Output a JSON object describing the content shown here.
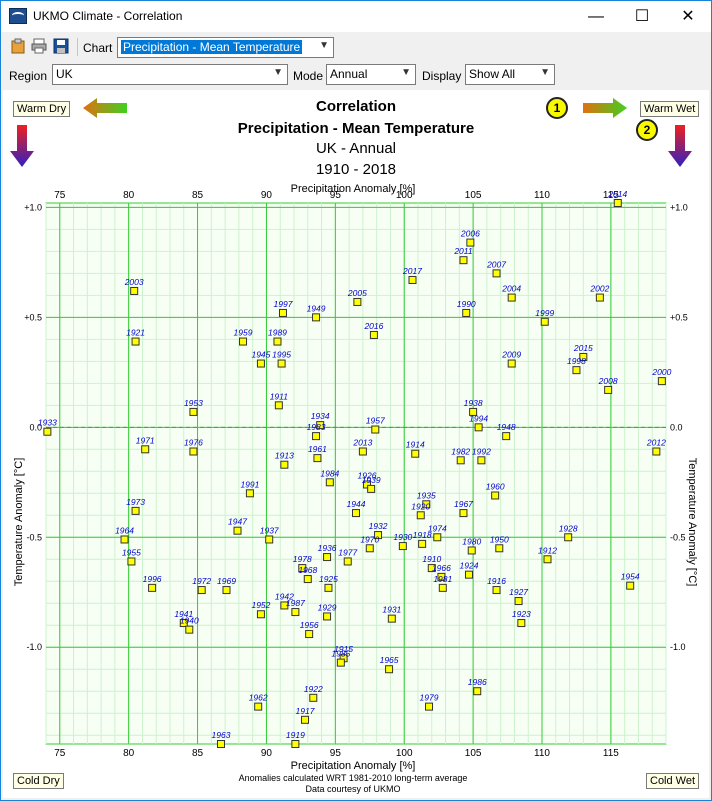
{
  "window": {
    "title": "UKMO Climate - Correlation",
    "minimize": "—",
    "maximize": "☐",
    "close": "✕"
  },
  "toolbar": {
    "chart_label": "Chart",
    "chart_value": "Precipitation - Mean Temperature"
  },
  "filters": {
    "region_label": "Region",
    "region_value": "UK",
    "mode_label": "Mode",
    "mode_value": "Annual",
    "display_label": "Display",
    "display_value": "Show All"
  },
  "corners": {
    "warm_dry": "Warm Dry",
    "warm_wet": "Warm Wet",
    "cold_dry": "Cold Dry",
    "cold_wet": "Cold Wet",
    "badge1": "1",
    "badge2": "2"
  },
  "footer": {
    "note1": "Anomalies calculated WRT 1981-2010 long-term average",
    "note2": "Data courtesy of UKMO"
  },
  "colors": {
    "grid_major": "#33cc33",
    "grid_minor": "#ccf2cc",
    "point": "#ffff00",
    "label": "#0000cc",
    "zero": "#33aa33"
  },
  "chart_data": {
    "type": "scatter",
    "title": "Correlation",
    "subtitle": "Precipitation - Mean Temperature",
    "subtitle2": "UK - Annual",
    "subtitle3": "1910 - 2018",
    "xlabel": "Precipitation Anomaly [%]",
    "ylabel": "Temperature Anomaly [°C]",
    "xlim": [
      74,
      119
    ],
    "ylim": [
      -1.44,
      1.02
    ],
    "xticks": [
      75,
      80,
      85,
      90,
      95,
      100,
      105,
      110,
      115
    ],
    "yticks": [
      1.0,
      0.5,
      0.0,
      -0.5,
      -1.0
    ],
    "ytick_labels": [
      "+1.0",
      "+0.5",
      "0.0",
      "-0.5",
      "-1.0"
    ],
    "points": [
      {
        "label": "2014",
        "x": 115.5,
        "y": 1.02
      },
      {
        "label": "2006",
        "x": 104.8,
        "y": 0.84
      },
      {
        "label": "2011",
        "x": 104.3,
        "y": 0.76
      },
      {
        "label": "2007",
        "x": 106.7,
        "y": 0.7
      },
      {
        "label": "2017",
        "x": 100.6,
        "y": 0.67
      },
      {
        "label": "2003",
        "x": 80.4,
        "y": 0.62
      },
      {
        "label": "2004",
        "x": 107.8,
        "y": 0.59
      },
      {
        "label": "2002",
        "x": 114.2,
        "y": 0.59
      },
      {
        "label": "2005",
        "x": 96.6,
        "y": 0.57
      },
      {
        "label": "1990",
        "x": 104.5,
        "y": 0.52
      },
      {
        "label": "1997",
        "x": 91.2,
        "y": 0.52
      },
      {
        "label": "1949",
        "x": 93.6,
        "y": 0.5
      },
      {
        "label": "1999",
        "x": 110.2,
        "y": 0.48
      },
      {
        "label": "2016",
        "x": 97.8,
        "y": 0.42
      },
      {
        "label": "1921",
        "x": 80.5,
        "y": 0.39
      },
      {
        "label": "1959",
        "x": 88.3,
        "y": 0.39
      },
      {
        "label": "1989",
        "x": 90.8,
        "y": 0.39
      },
      {
        "label": "2015",
        "x": 113.0,
        "y": 0.32
      },
      {
        "label": "1945",
        "x": 89.6,
        "y": 0.29
      },
      {
        "label": "1995",
        "x": 91.1,
        "y": 0.29
      },
      {
        "label": "2009",
        "x": 107.8,
        "y": 0.29
      },
      {
        "label": "1998",
        "x": 112.5,
        "y": 0.26
      },
      {
        "label": "2000",
        "x": 118.7,
        "y": 0.21
      },
      {
        "label": "2008",
        "x": 114.8,
        "y": 0.17
      },
      {
        "label": "1911",
        "x": 90.9,
        "y": 0.1
      },
      {
        "label": "1938",
        "x": 105.0,
        "y": 0.07
      },
      {
        "label": "1953",
        "x": 84.7,
        "y": 0.07
      },
      {
        "label": "1934",
        "x": 93.9,
        "y": 0.01
      },
      {
        "label": "1994",
        "x": 105.4,
        "y": 0.0
      },
      {
        "label": "1957",
        "x": 97.9,
        "y": -0.01
      },
      {
        "label": "1983",
        "x": 93.6,
        "y": -0.04
      },
      {
        "label": "1933",
        "x": 74.1,
        "y": -0.02
      },
      {
        "label": "1948",
        "x": 107.4,
        "y": -0.04
      },
      {
        "label": "1971",
        "x": 81.2,
        "y": -0.1
      },
      {
        "label": "1976",
        "x": 84.7,
        "y": -0.11
      },
      {
        "label": "2013",
        "x": 97.0,
        "y": -0.11
      },
      {
        "label": "1961",
        "x": 93.7,
        "y": -0.14
      },
      {
        "label": "1914",
        "x": 100.8,
        "y": -0.12
      },
      {
        "label": "1982",
        "x": 104.1,
        "y": -0.15
      },
      {
        "label": "1992",
        "x": 105.6,
        "y": -0.15
      },
      {
        "label": "2012",
        "x": 118.3,
        "y": -0.11
      },
      {
        "label": "1913",
        "x": 91.3,
        "y": -0.17
      },
      {
        "label": "1984",
        "x": 94.6,
        "y": -0.25
      },
      {
        "label": "1926",
        "x": 97.3,
        "y": -0.26
      },
      {
        "label": "1939",
        "x": 97.6,
        "y": -0.28
      },
      {
        "label": "1991",
        "x": 88.8,
        "y": -0.3
      },
      {
        "label": "1960",
        "x": 106.6,
        "y": -0.31
      },
      {
        "label": "1935",
        "x": 101.6,
        "y": -0.35
      },
      {
        "label": "1944",
        "x": 96.5,
        "y": -0.39
      },
      {
        "label": "1920",
        "x": 101.2,
        "y": -0.4
      },
      {
        "label": "1967",
        "x": 104.3,
        "y": -0.39
      },
      {
        "label": "1973",
        "x": 80.5,
        "y": -0.38
      },
      {
        "label": "1947",
        "x": 87.9,
        "y": -0.47
      },
      {
        "label": "1932",
        "x": 98.1,
        "y": -0.49
      },
      {
        "label": "1937",
        "x": 90.2,
        "y": -0.51
      },
      {
        "label": "1964",
        "x": 79.7,
        "y": -0.51
      },
      {
        "label": "1918",
        "x": 101.3,
        "y": -0.53
      },
      {
        "label": "1974",
        "x": 102.4,
        "y": -0.5
      },
      {
        "label": "1928",
        "x": 111.9,
        "y": -0.5
      },
      {
        "label": "1970",
        "x": 97.5,
        "y": -0.55
      },
      {
        "label": "1930",
        "x": 99.9,
        "y": -0.54
      },
      {
        "label": "1980",
        "x": 104.9,
        "y": -0.56
      },
      {
        "label": "1950",
        "x": 106.9,
        "y": -0.55
      },
      {
        "label": "1936",
        "x": 94.4,
        "y": -0.59
      },
      {
        "label": "1912",
        "x": 110.4,
        "y": -0.6
      },
      {
        "label": "1955",
        "x": 80.2,
        "y": -0.61
      },
      {
        "label": "1977",
        "x": 95.9,
        "y": -0.61
      },
      {
        "label": "1978",
        "x": 92.6,
        "y": -0.64
      },
      {
        "label": "1910",
        "x": 102.0,
        "y": -0.64
      },
      {
        "label": "1966",
        "x": 102.7,
        "y": -0.68
      },
      {
        "label": "1924",
        "x": 104.7,
        "y": -0.67
      },
      {
        "label": "1968",
        "x": 93.0,
        "y": -0.69
      },
      {
        "label": "1996",
        "x": 81.7,
        "y": -0.73
      },
      {
        "label": "1972",
        "x": 85.3,
        "y": -0.74
      },
      {
        "label": "1969",
        "x": 87.1,
        "y": -0.74
      },
      {
        "label": "1925",
        "x": 94.5,
        "y": -0.73
      },
      {
        "label": "1981",
        "x": 102.8,
        "y": -0.73
      },
      {
        "label": "1916",
        "x": 106.7,
        "y": -0.74
      },
      {
        "label": "1954",
        "x": 116.4,
        "y": -0.72
      },
      {
        "label": "1927",
        "x": 108.3,
        "y": -0.79
      },
      {
        "label": "1942",
        "x": 91.3,
        "y": -0.81
      },
      {
        "label": "1952",
        "x": 89.6,
        "y": -0.85
      },
      {
        "label": "1987",
        "x": 92.1,
        "y": -0.84
      },
      {
        "label": "1929",
        "x": 94.4,
        "y": -0.86
      },
      {
        "label": "1931",
        "x": 99.1,
        "y": -0.87
      },
      {
        "label": "1923",
        "x": 108.5,
        "y": -0.89
      },
      {
        "label": "1941",
        "x": 84.0,
        "y": -0.89
      },
      {
        "label": "1940",
        "x": 84.4,
        "y": -0.92
      },
      {
        "label": "1956",
        "x": 93.1,
        "y": -0.94
      },
      {
        "label": "1915",
        "x": 95.6,
        "y": -1.05
      },
      {
        "label": "1985",
        "x": 95.4,
        "y": -1.07
      },
      {
        "label": "1965",
        "x": 98.9,
        "y": -1.1
      },
      {
        "label": "1986",
        "x": 105.3,
        "y": -1.2
      },
      {
        "label": "1922",
        "x": 93.4,
        "y": -1.23
      },
      {
        "label": "1962",
        "x": 89.4,
        "y": -1.27
      },
      {
        "label": "1979",
        "x": 101.8,
        "y": -1.27
      },
      {
        "label": "1917",
        "x": 92.8,
        "y": -1.33
      },
      {
        "label": "1963",
        "x": 86.7,
        "y": -1.44
      },
      {
        "label": "1919",
        "x": 92.1,
        "y": -1.44
      }
    ]
  }
}
